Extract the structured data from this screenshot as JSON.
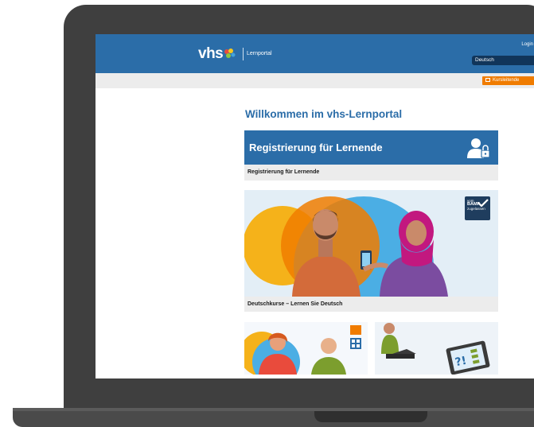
{
  "header": {
    "logo_text": "vhs",
    "portal_label": "Lernportal",
    "login_label": "Login",
    "language": "Deutsch"
  },
  "toolbar": {
    "teacher_button_label": "Kursleitende"
  },
  "main": {
    "welcome_title": "Willkommen im vhs-Lernportal",
    "registration_banner_title": "Registrierung für Lernende",
    "registration_caption": "Registrierung für Lernende",
    "course_caption": "Deutschkurse – Lernen Sie Deutsch",
    "bamf_badge": {
      "line1": "vom",
      "line2": "BAMF",
      "line3": "zugelassen"
    }
  },
  "colors": {
    "brand_blue": "#2b6da8",
    "accent_orange": "#f07c00",
    "laptop_frame": "#3f3f3f"
  }
}
